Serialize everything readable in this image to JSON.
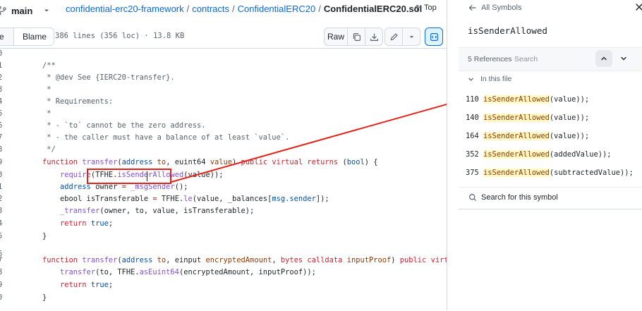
{
  "header": {
    "branch": "main",
    "breadcrumb": [
      "confidential-erc20-framework",
      "contracts",
      "ConfidentialERC20"
    ],
    "current_file": "ConfidentialERC20.sol",
    "top_label": "Top"
  },
  "toolbar": {
    "code_tab": "e",
    "blame_tab": "Blame",
    "file_info": "386 lines (356 loc) · 13.8 KB",
    "raw_label": "Raw"
  },
  "code_lines": [
    {
      "ln": "0",
      "tokens": []
    },
    {
      "ln": "1",
      "tokens": [
        {
          "t": "/**",
          "c": "com"
        }
      ]
    },
    {
      "ln": "2",
      "tokens": [
        {
          "t": " * @dev See {IERC20-transfer}.",
          "c": "com"
        }
      ]
    },
    {
      "ln": "3",
      "tokens": [
        {
          "t": " *",
          "c": "com"
        }
      ]
    },
    {
      "ln": "4",
      "tokens": [
        {
          "t": " * Requirements:",
          "c": "com"
        }
      ]
    },
    {
      "ln": "5",
      "tokens": [
        {
          "t": " *",
          "c": "com"
        }
      ]
    },
    {
      "ln": "6",
      "tokens": [
        {
          "t": " * - `to` cannot be the zero address.",
          "c": "com"
        }
      ]
    },
    {
      "ln": "7",
      "tokens": [
        {
          "t": " * - the caller must have a balance of at least `value`.",
          "c": "com"
        }
      ]
    },
    {
      "ln": "8",
      "tokens": [
        {
          "t": " */",
          "c": "com"
        }
      ]
    },
    {
      "ln": "9",
      "tokens": [
        {
          "t": "function ",
          "c": "kw"
        },
        {
          "t": "transfer",
          "c": "fn"
        },
        {
          "t": "(",
          "c": "txt"
        },
        {
          "t": "address ",
          "c": "ty"
        },
        {
          "t": "to",
          "c": "var"
        },
        {
          "t": ", euint64 ",
          "c": "txt"
        },
        {
          "t": "value",
          "c": "var"
        },
        {
          "t": ") ",
          "c": "txt"
        },
        {
          "t": "public virtual returns ",
          "c": "kw"
        },
        {
          "t": "(",
          "c": "txt"
        },
        {
          "t": "bool",
          "c": "ty"
        },
        {
          "t": ") {",
          "c": "txt"
        }
      ]
    },
    {
      "ln": "0",
      "tokens": [
        {
          "t": "    require",
          "c": "fn"
        },
        {
          "t": "(TFHE.",
          "c": "txt"
        },
        {
          "t": "isSenderAllowed",
          "c": "fn"
        },
        {
          "t": "(value));",
          "c": "txt"
        }
      ]
    },
    {
      "ln": "1",
      "tokens": [
        {
          "t": "    address ",
          "c": "ty"
        },
        {
          "t": "owner",
          "c": "txt"
        },
        {
          "t": " = ",
          "c": "kw"
        },
        {
          "t": "_msgSender",
          "c": "fn"
        },
        {
          "t": "();",
          "c": "txt"
        }
      ]
    },
    {
      "ln": "2",
      "tokens": [
        {
          "t": "    ebool isTransferable ",
          "c": "txt"
        },
        {
          "t": "= ",
          "c": "kw"
        },
        {
          "t": "TFHE.",
          "c": "txt"
        },
        {
          "t": "le",
          "c": "fn"
        },
        {
          "t": "(value, _balances[",
          "c": "txt"
        },
        {
          "t": "msg.sender",
          "c": "ty"
        },
        {
          "t": "]);",
          "c": "txt"
        }
      ]
    },
    {
      "ln": "3",
      "tokens": [
        {
          "t": "    _transfer",
          "c": "fn"
        },
        {
          "t": "(owner, to, value, isTransferable);",
          "c": "txt"
        }
      ]
    },
    {
      "ln": "4",
      "tokens": [
        {
          "t": "    return ",
          "c": "kw"
        },
        {
          "t": "true",
          "c": "ty"
        },
        {
          "t": ";",
          "c": "txt"
        }
      ]
    },
    {
      "ln": "5",
      "tokens": [
        {
          "t": "}",
          "c": "txt"
        }
      ]
    },
    {
      "ln": "6",
      "tokens": []
    },
    {
      "ln": "7",
      "tokens": [
        {
          "t": "function ",
          "c": "kw"
        },
        {
          "t": "transfer",
          "c": "fn"
        },
        {
          "t": "(",
          "c": "txt"
        },
        {
          "t": "address ",
          "c": "ty"
        },
        {
          "t": "to",
          "c": "var"
        },
        {
          "t": ", einput ",
          "c": "txt"
        },
        {
          "t": "encryptedAmount",
          "c": "var"
        },
        {
          "t": ", ",
          "c": "txt"
        },
        {
          "t": "bytes calldata ",
          "c": "kw"
        },
        {
          "t": "inputProof",
          "c": "var"
        },
        {
          "t": ") ",
          "c": "txt"
        },
        {
          "t": "public virtual retu",
          "c": "kw"
        }
      ]
    },
    {
      "ln": "8",
      "tokens": [
        {
          "t": "    transfer",
          "c": "fn"
        },
        {
          "t": "(to, TFHE.",
          "c": "txt"
        },
        {
          "t": "asEuint64",
          "c": "fn"
        },
        {
          "t": "(encryptedAmount, inputProof));",
          "c": "txt"
        }
      ]
    },
    {
      "ln": "9",
      "tokens": [
        {
          "t": "    return ",
          "c": "kw"
        },
        {
          "t": "true",
          "c": "ty"
        },
        {
          "t": ";",
          "c": "txt"
        }
      ]
    },
    {
      "ln": "0",
      "tokens": [
        {
          "t": "}",
          "c": "txt"
        }
      ]
    }
  ],
  "symbols_panel": {
    "back_label": "All Symbols",
    "symbol_name": "isSenderAllowed",
    "references_count": "5 References",
    "search_placeholder": "Search",
    "in_this_file": "In this file",
    "references": [
      {
        "line": "110",
        "match": "isSenderAllowed",
        "rest": "(value));"
      },
      {
        "line": "140",
        "match": "isSenderAllowed",
        "rest": "(value));"
      },
      {
        "line": "164",
        "match": "isSenderAllowed",
        "rest": "(value));"
      },
      {
        "line": "352",
        "match": "isSenderAllowed",
        "rest": "(addedValue));"
      },
      {
        "line": "375",
        "match": "isSenderAllowed",
        "rest": "(subtractedValue));"
      }
    ],
    "search_symbol_label": "Search for this symbol"
  },
  "colors": {
    "link": "#0969da",
    "keyword": "#cf222e",
    "function": "#8250df",
    "type": "#0550ae",
    "variable": "#953800",
    "comment": "#59636e",
    "annotation": "#e3231a",
    "highlight_bg": "#fff8c5"
  },
  "icons": [
    "branch-icon",
    "chevron-down-icon",
    "arrow-up-icon",
    "copy-icon",
    "download-icon",
    "pencil-icon",
    "symbols-icon",
    "arrow-left-icon",
    "close-icon",
    "chevron-up-icon",
    "search-icon"
  ]
}
